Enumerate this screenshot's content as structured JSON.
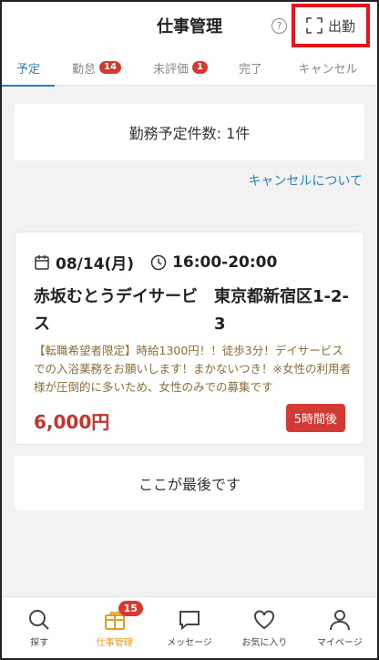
{
  "header": {
    "title": "仕事管理",
    "help_icon": "question-circle-icon",
    "checkin_label": "出勤",
    "checkin_icon": "scan-frame-icon",
    "highlight_color": "#e8131b"
  },
  "tabs": [
    {
      "label": "予定",
      "badge": null,
      "active": true
    },
    {
      "label": "勤怠",
      "badge": "14",
      "active": false
    },
    {
      "label": "未評価",
      "badge": "1",
      "active": false
    },
    {
      "label": "完了",
      "badge": null,
      "active": false
    },
    {
      "label": "キャンセル",
      "badge": null,
      "active": false
    }
  ],
  "summary": {
    "count_text": "勤務予定件数: 1件",
    "cancel_link": "キャンセルについて"
  },
  "job": {
    "date": "08/14(月)",
    "time": "16:00-20:00",
    "facility": "赤坂むとうデイサービス",
    "address": "東京都新宿区1-2-3",
    "description": "【転職希望者限定】時給1300円！！徒歩3分！デイサービスでの入浴業務をお願いします！まかないつき！※女性の利用者様が圧倒的に多いため、女性のみでの募集です",
    "wage": "6,000円",
    "starts_in": "5時間後"
  },
  "end_text": "ここが最後です",
  "bottom_nav": [
    {
      "label": "探す",
      "icon": "search-icon",
      "badge": null,
      "active": false
    },
    {
      "label": "仕事管理",
      "icon": "gift-box-icon",
      "badge": "15",
      "active": true
    },
    {
      "label": "メッセージ",
      "icon": "chat-bubble-icon",
      "badge": null,
      "active": false
    },
    {
      "label": "お気に入り",
      "icon": "heart-icon",
      "badge": null,
      "active": false
    },
    {
      "label": "マイページ",
      "icon": "user-icon",
      "badge": null,
      "active": false
    }
  ],
  "colors": {
    "accent": "#2b7fb8",
    "badge": "#d33a35",
    "wage": "#c6332d",
    "nav_active": "#e79b1a"
  }
}
